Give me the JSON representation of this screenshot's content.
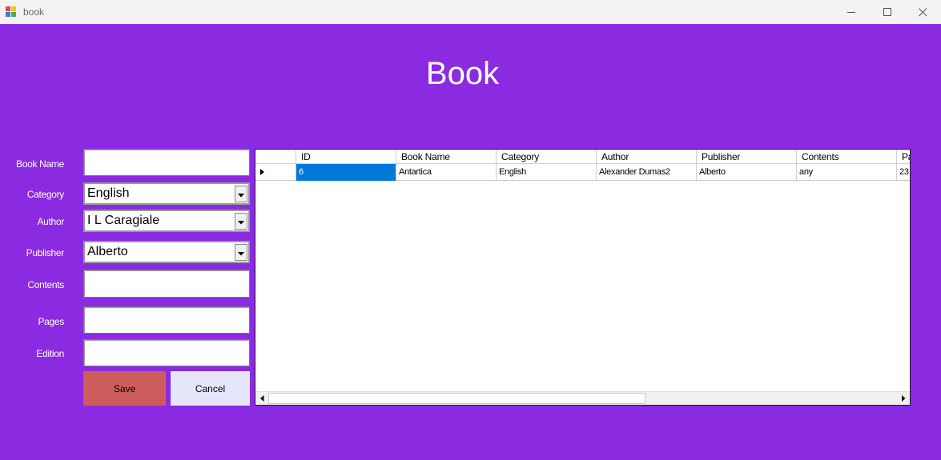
{
  "window": {
    "title": "book",
    "buttons": {
      "minimize_icon": "minimize-icon",
      "maximize_icon": "maximize-icon",
      "close_icon": "close-icon"
    }
  },
  "heading": "Book",
  "form": {
    "book_name": {
      "label": "Book Name",
      "value": ""
    },
    "category": {
      "label": "Category",
      "value": "English"
    },
    "author": {
      "label": "Author",
      "value": "I L Caragiale"
    },
    "publisher": {
      "label": "Publisher",
      "value": "Alberto"
    },
    "contents": {
      "label": "Contents",
      "value": ""
    },
    "pages": {
      "label": "Pages",
      "value": ""
    },
    "edition": {
      "label": "Edition",
      "value": ""
    }
  },
  "buttons": {
    "save": "Save",
    "cancel": "Cancel"
  },
  "table": {
    "columns": [
      "ID",
      "Book Name",
      "Category",
      "Author",
      "Publisher",
      "Contents",
      "Pa"
    ],
    "rows": [
      [
        "6",
        "Antartica",
        "English",
        "Alexander Dumas2",
        "Alberto",
        "any",
        "23"
      ]
    ],
    "horizontal_scroll_position": 0.0,
    "horizontal_scroll_visible_fraction": 0.6
  },
  "colors": {
    "background": "#8a2be2",
    "save_button": "#cd5c5c",
    "cancel_button": "#e6e6fa",
    "selection": "#0078d7"
  }
}
